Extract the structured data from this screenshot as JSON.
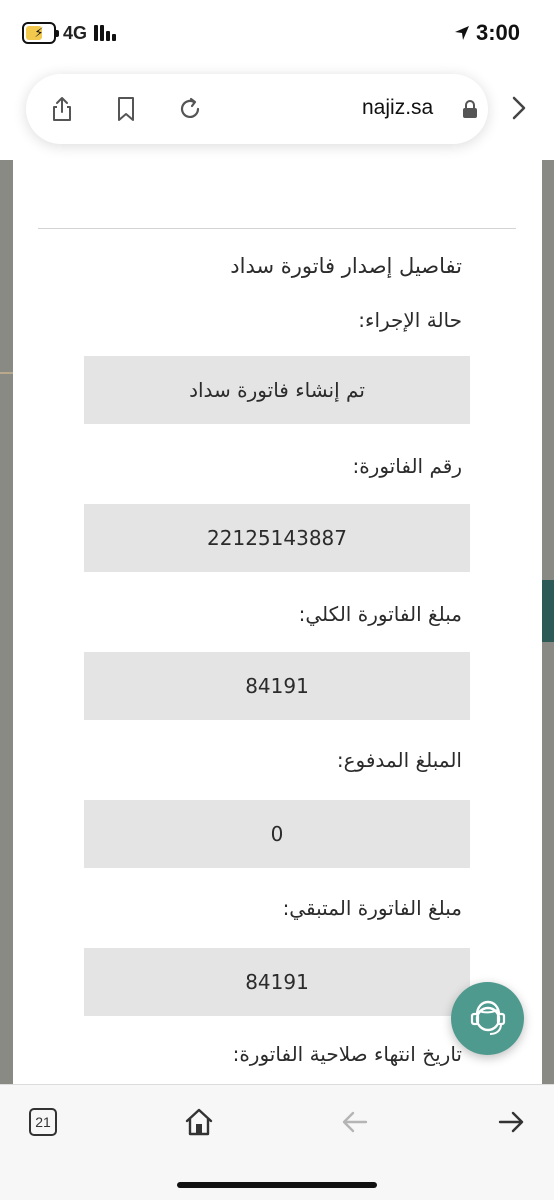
{
  "status_bar": {
    "network": "4G",
    "time": "3:00",
    "battery_level": 0.55,
    "icons": [
      "battery-charging-icon",
      "signal-bars-icon",
      "location-arrow-icon"
    ]
  },
  "browser": {
    "domain": "najiz.sa",
    "icons": [
      "share-icon",
      "bookmark-icon",
      "reload-icon",
      "lock-icon",
      "chevron-right-icon"
    ]
  },
  "invoice": {
    "section_title": "تفاصيل إصدار فاتورة سداد",
    "status_label": "حالة الإجراء:",
    "status_value": "تم إنشاء فاتورة سداد",
    "number_label": "رقم الفاتورة:",
    "number_value": "22125143887",
    "total_label": "مبلغ الفاتورة الكلي:",
    "total_value": "84191",
    "paid_label": "المبلغ المدفوع:",
    "paid_value": "0",
    "remaining_label": "مبلغ الفاتورة المتبقي:",
    "remaining_value": "84191",
    "expiry_label": "تاريخ انتهاء صلاحية الفاتورة:"
  },
  "support": {
    "icon": "support-agent-icon",
    "color": "#4f9a8e"
  },
  "toolbar": {
    "tab_count": "21",
    "icons": [
      "tabs-icon",
      "home-icon",
      "back-arrow-icon",
      "forward-arrow-icon"
    ]
  },
  "colors": {
    "field_background": "#e4e4e4",
    "accent": "#2d5a56"
  }
}
